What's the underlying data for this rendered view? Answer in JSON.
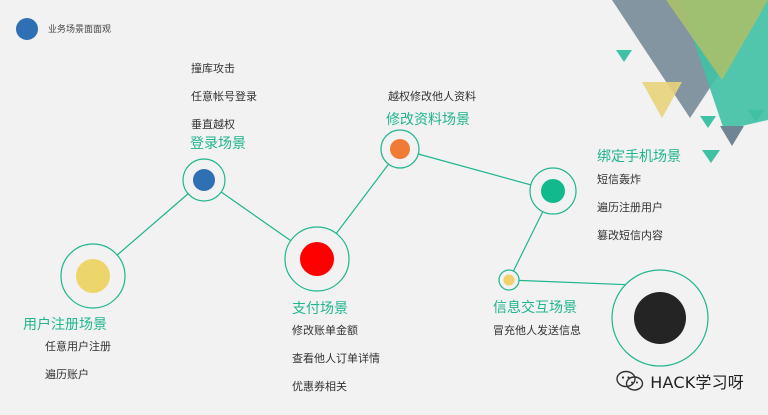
{
  "header": {
    "title": "业务场景面面观"
  },
  "scenes": {
    "register": {
      "title": "用户注册场景",
      "items": [
        "任意用户注册",
        "遍历账户"
      ]
    },
    "login": {
      "title": "登录场景",
      "items": [
        "撞库攻击",
        "任意帐号登录",
        "垂直越权"
      ]
    },
    "payment": {
      "title": "支付场景",
      "items": [
        "修改账单金额",
        "查看他人订单详情",
        "优惠券相关"
      ]
    },
    "profile": {
      "title": "修改资料场景",
      "items": [
        "越权修改他人资料"
      ]
    },
    "phone": {
      "title": "绑定手机场景",
      "items": [
        "短信轰炸",
        "遍历注册用户",
        "篡改短信内容"
      ]
    },
    "interaction": {
      "title": "信息交互场景",
      "items": [
        "冒充他人发送信息"
      ]
    }
  },
  "node_colors": {
    "register": "#ecd56a",
    "login": "#2f6fb3",
    "payment": "#ff0000",
    "profile": "#ef7b37",
    "phone": "#12b98c",
    "interaction": "#efd36a",
    "final": "#242424",
    "ring": "#1fb58f",
    "line": "#1fb58f"
  },
  "decor_colors": {
    "slate": "#6f8593",
    "teal": "#3fc1a4",
    "olive": "#a9c06c",
    "yellow": "#e8d37a"
  },
  "watermark": {
    "icon": "wechat-icon",
    "text": "HACK学习呀"
  }
}
